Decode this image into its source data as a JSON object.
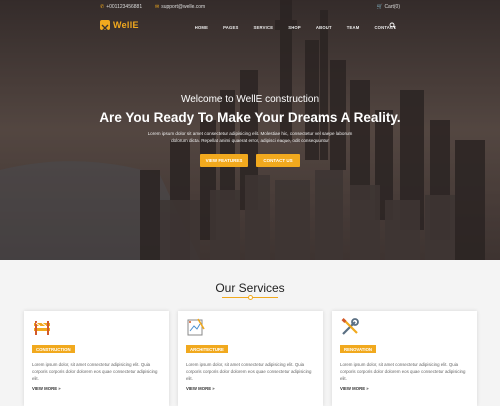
{
  "topbar": {
    "phone": "+001123456881",
    "email": "support@welle.com",
    "cart": "Cart(0)"
  },
  "brand": {
    "name": "WellE"
  },
  "nav": [
    {
      "label": "HOME"
    },
    {
      "label": "PAGES"
    },
    {
      "label": "SERVICE"
    },
    {
      "label": "SHOP"
    },
    {
      "label": "ABOUT"
    },
    {
      "label": "TEAM"
    },
    {
      "label": "CONTACT"
    }
  ],
  "hero": {
    "welcome": "Welcome to WellE construction",
    "title": "Are You Ready To Make Your Dreams A Reality.",
    "desc_line1": "Lorem ipsum dolor sit amet consectetur adipisicing elit. Molestiae hic, consectetur vel saepe laborum",
    "desc_line2": "dolorum dicta. Repellat animi quaerat error, adipisci eaque, odit consequuntur",
    "btn_features": "VIEW FEATURES",
    "btn_contact": "CONTACT US"
  },
  "services": {
    "title": "Our Services",
    "cards": [
      {
        "badge": "CONSTRUCTION",
        "text": "Lorem ipsum dolor, sit amet consectetur adipisicing elit. Quia corporis corporis dolor dolorem eos quae consectetur adipisicing elit.",
        "more": "VIEW MORE »",
        "icon": "barrier-icon"
      },
      {
        "badge": "ARCHITECTURE",
        "text": "Lorem ipsum dolor, sit amet consectetur adipisicing elit. Quia corporis corporis dolor dolorem eos quae consectetur adipisicing elit.",
        "more": "VIEW MORE »",
        "icon": "blueprint-icon"
      },
      {
        "badge": "RENOVATION",
        "text": "Lorem ipsum dolor, sit amet consectetur adipisicing elit. Quia corporis corporis dolor dolorem eos quae consectetur adipisicing elit.",
        "more": "VIEW MORE »",
        "icon": "tools-icon"
      }
    ]
  },
  "colors": {
    "accent": "#f1a91e"
  }
}
